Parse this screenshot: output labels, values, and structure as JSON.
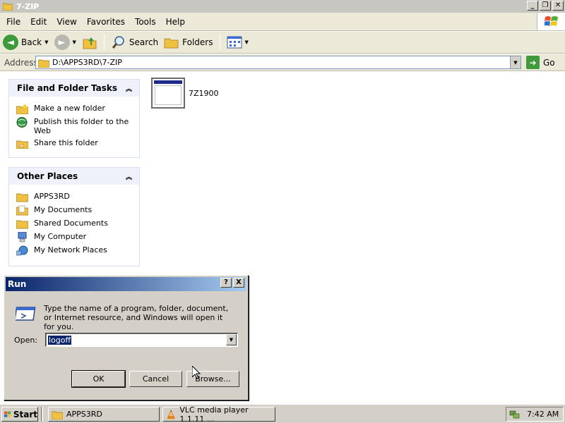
{
  "window": {
    "title": "7-ZIP",
    "icon": "folder-icon"
  },
  "menu": {
    "items": [
      "File",
      "Edit",
      "View",
      "Favorites",
      "Tools",
      "Help"
    ]
  },
  "toolbar": {
    "back_label": "Back",
    "search_label": "Search",
    "folders_label": "Folders"
  },
  "address": {
    "label": "Address",
    "value": "D:\\APPS3RD\\7-ZIP",
    "go_label": "Go"
  },
  "tasks_panel": {
    "title": "File and Folder Tasks",
    "items": [
      {
        "label": "Make a new folder",
        "icon": "new-folder-icon"
      },
      {
        "label": "Publish this folder to the Web",
        "icon": "publish-web-icon"
      },
      {
        "label": "Share this folder",
        "icon": "share-folder-icon"
      }
    ]
  },
  "places_panel": {
    "title": "Other Places",
    "items": [
      {
        "label": "APPS3RD",
        "icon": "folder-icon"
      },
      {
        "label": "My Documents",
        "icon": "my-documents-icon"
      },
      {
        "label": "Shared Documents",
        "icon": "folder-icon"
      },
      {
        "label": "My Computer",
        "icon": "my-computer-icon"
      },
      {
        "label": "My Network Places",
        "icon": "network-places-icon"
      }
    ]
  },
  "files": [
    {
      "name": "7Z1900",
      "icon": "application-window-icon"
    }
  ],
  "run_dialog": {
    "title": "Run",
    "help_label": "?",
    "close_label": "X",
    "description": "Type the name of a program, folder, document, or Internet resource, and Windows will open it for you.",
    "open_label": "Open:",
    "open_value": "logoff",
    "ok_label": "OK",
    "cancel_label": "Cancel",
    "browse_label": "Browse..."
  },
  "taskbar": {
    "start_label": "Start",
    "tasks": [
      {
        "label": "APPS3RD",
        "icon": "folder-icon"
      },
      {
        "label": "VLC media player 1.1.11 ...",
        "icon": "vlc-cone-icon"
      }
    ],
    "time": "7:42 AM"
  },
  "colors": {
    "run_title_start": "#0a246a",
    "run_title_end": "#a6caf0",
    "panel_header": "#eef1f9",
    "go_green": "#3e9a3b"
  }
}
